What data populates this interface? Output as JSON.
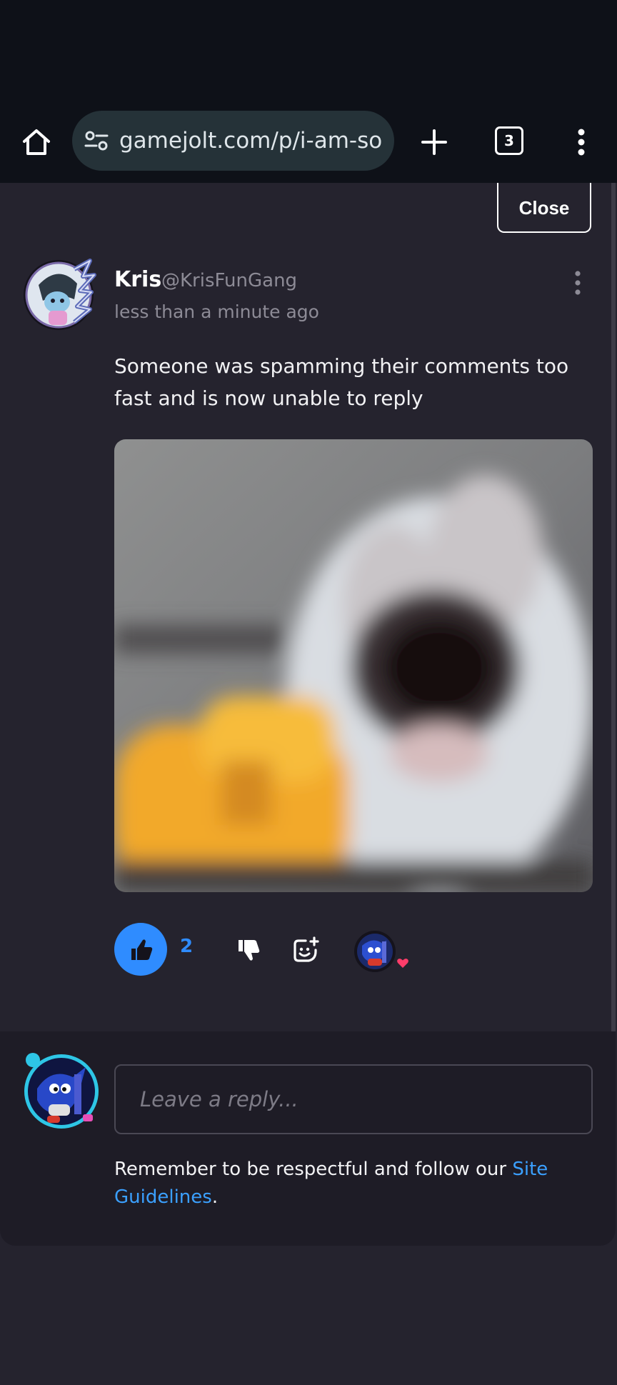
{
  "browser": {
    "url": "gamejolt.com/p/i-am-so",
    "tab_count": "3"
  },
  "modal": {
    "close_label": "Close"
  },
  "post": {
    "author_name": "Kris",
    "author_handle": "@KrisFunGang",
    "time": "less than a minute ago",
    "text": "Someone was spamming their comments too fast and is now unable to reply",
    "like_count": "2"
  },
  "reply": {
    "placeholder": "Leave a reply...",
    "guidelines_prefix": "Remember to be respectful and follow our ",
    "guidelines_link": "Site Guidelines",
    "guidelines_suffix": "."
  },
  "colors": {
    "accent": "#2f8cff",
    "link": "#3ba0ff",
    "background": "#25232e",
    "heart": "#ff3d6a"
  },
  "icons": {
    "home": "home-icon",
    "site_settings": "tune-icon",
    "new_tab": "plus-icon",
    "tabs": "tab-switcher-icon",
    "menu": "more-vert-icon",
    "like": "thumbs-up-icon",
    "dislike": "thumbs-down-icon",
    "sticker": "add-sticker-icon",
    "heart": "heart-icon"
  }
}
